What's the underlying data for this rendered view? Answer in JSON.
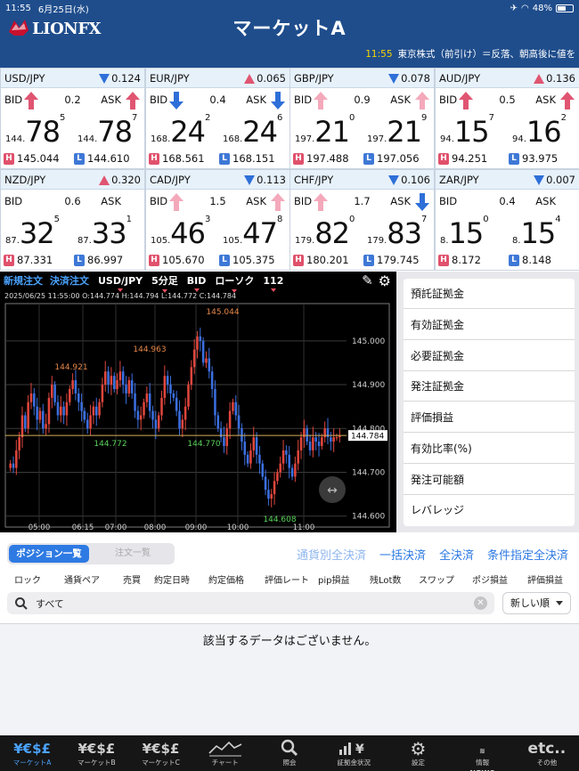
{
  "status_bar": {
    "time": "11:55",
    "date": "6月25日(水)",
    "battery": "48%"
  },
  "header": {
    "logo": "LIONFX",
    "title": "マーケットA",
    "ticker_time": "11:55",
    "ticker_text": "東京株式（前引け）＝反落、朝高後に値を"
  },
  "quotes": [
    {
      "pair": "USD/JPY",
      "change": "0.124",
      "change_dir": "down",
      "spread": "0.2",
      "bid_label": "BID",
      "ask_label": "ASK",
      "bid_dir": "up",
      "ask_dir": "up",
      "bid_pre": "144.",
      "bid_big": "78",
      "bid_frac": "5",
      "ask_pre": "144.",
      "ask_big": "78",
      "ask_frac": "7",
      "high": "145.044",
      "low": "144.610"
    },
    {
      "pair": "EUR/JPY",
      "change": "0.065",
      "change_dir": "up",
      "spread": "0.4",
      "bid_label": "BID",
      "ask_label": "ASK",
      "bid_dir": "down",
      "ask_dir": "down",
      "bid_pre": "168.",
      "bid_big": "24",
      "bid_frac": "2",
      "ask_pre": "168.",
      "ask_big": "24",
      "ask_frac": "6",
      "high": "168.561",
      "low": "168.151"
    },
    {
      "pair": "GBP/JPY",
      "change": "0.078",
      "change_dir": "down",
      "spread": "0.9",
      "bid_label": "BID",
      "ask_label": "ASK",
      "bid_dir": "up-light",
      "ask_dir": "up-light",
      "bid_pre": "197.",
      "bid_big": "21",
      "bid_frac": "0",
      "ask_pre": "197.",
      "ask_big": "21",
      "ask_frac": "9",
      "high": "197.488",
      "low": "197.056"
    },
    {
      "pair": "AUD/JPY",
      "change": "0.136",
      "change_dir": "up",
      "spread": "0.5",
      "bid_label": "BID",
      "ask_label": "ASK",
      "bid_dir": "up",
      "ask_dir": "up",
      "bid_pre": "94.",
      "bid_big": "15",
      "bid_frac": "7",
      "ask_pre": "94.",
      "ask_big": "16",
      "ask_frac": "2",
      "high": "94.251",
      "low": "93.975"
    },
    {
      "pair": "NZD/JPY",
      "change": "0.320",
      "change_dir": "up",
      "spread": "0.6",
      "bid_label": "BID",
      "ask_label": "ASK",
      "bid_dir": "none",
      "ask_dir": "none",
      "bid_pre": "87.",
      "bid_big": "32",
      "bid_frac": "5",
      "ask_pre": "87.",
      "ask_big": "33",
      "ask_frac": "1",
      "high": "87.331",
      "low": "86.997"
    },
    {
      "pair": "CAD/JPY",
      "change": "0.113",
      "change_dir": "down",
      "spread": "1.5",
      "bid_label": "BID",
      "ask_label": "ASK",
      "bid_dir": "up-light",
      "ask_dir": "up-light",
      "bid_pre": "105.",
      "bid_big": "46",
      "bid_frac": "3",
      "ask_pre": "105.",
      "ask_big": "47",
      "ask_frac": "8",
      "high": "105.670",
      "low": "105.375"
    },
    {
      "pair": "CHF/JPY",
      "change": "0.106",
      "change_dir": "down",
      "spread": "1.7",
      "bid_label": "BID",
      "ask_label": "ASK",
      "bid_dir": "up-light",
      "ask_dir": "down",
      "bid_pre": "179.",
      "bid_big": "82",
      "bid_frac": "0",
      "ask_pre": "179.",
      "ask_big": "83",
      "ask_frac": "7",
      "high": "180.201",
      "low": "179.745"
    },
    {
      "pair": "ZAR/JPY",
      "change": "0.007",
      "change_dir": "down",
      "spread": "0.4",
      "bid_label": "BID",
      "ask_label": "ASK",
      "bid_dir": "none",
      "ask_dir": "none",
      "bid_pre": "8.",
      "bid_big": "15",
      "bid_frac": "0",
      "ask_pre": "8.",
      "ask_big": "15",
      "ask_frac": "4",
      "high": "8.172",
      "low": "8.148"
    }
  ],
  "chart_toolbar": {
    "new_order": "新規注文",
    "settle_order": "決済注文",
    "pair": "USD/JPY",
    "period": "5分足",
    "side": "BID",
    "style": "ローソク",
    "count": "112"
  },
  "chart_info": "2025/06/25 11:55:00   O:144.774  H:144.794  L:144.772  C:144.784",
  "chart_data": {
    "type": "candlestick",
    "pair": "USD/JPY",
    "period": "5分足",
    "ylim": [
      144.575,
      145.085
    ],
    "y_ticks": [
      "145.000",
      "144.900",
      "144.800",
      "144.700",
      "144.600"
    ],
    "x_ticks": [
      "05:00",
      "06:15",
      "07:00",
      "08:00",
      "09:00",
      "10:00",
      "11:00"
    ],
    "current_price": "144.784",
    "annotations": [
      {
        "label": "145.044",
        "kind": "high"
      },
      {
        "label": "144.963",
        "kind": "high"
      },
      {
        "label": "144.921",
        "kind": "high"
      },
      {
        "label": "144.772",
        "kind": "low"
      },
      {
        "label": "144.770",
        "kind": "low"
      },
      {
        "label": "144.608",
        "kind": "low"
      }
    ],
    "close_path": [
      144.72,
      144.71,
      144.75,
      144.78,
      144.83,
      144.8,
      144.86,
      144.88,
      144.85,
      144.82,
      144.84,
      144.8,
      144.81,
      144.87,
      144.9,
      144.86,
      144.83,
      144.85,
      144.83,
      144.86,
      144.89,
      144.91,
      144.88,
      144.86,
      144.84,
      144.82,
      144.8,
      144.83,
      144.85,
      144.83,
      144.86,
      144.9,
      144.93,
      144.9,
      144.92,
      144.89,
      144.91,
      144.93,
      144.9,
      144.88,
      144.91,
      144.88,
      144.84,
      144.82,
      144.83,
      144.86,
      144.88,
      144.84,
      144.82,
      144.8,
      144.83,
      144.87,
      144.92,
      144.9,
      144.88,
      144.87,
      144.84,
      144.8,
      144.82,
      144.85,
      144.9,
      144.94,
      144.98,
      145.01,
      145.0,
      144.95,
      144.96,
      144.93,
      144.89,
      144.83,
      144.8,
      144.78,
      144.76,
      144.8,
      144.84,
      144.86,
      144.83,
      144.8,
      144.77,
      144.74,
      144.72,
      144.75,
      144.78,
      144.74,
      144.72,
      144.69,
      144.66,
      144.64,
      144.65,
      144.68,
      144.7,
      144.72,
      144.75,
      144.74,
      144.71,
      144.69,
      144.72,
      144.75,
      144.78,
      144.8,
      144.77,
      144.75,
      144.78,
      144.77,
      144.76,
      144.78,
      144.8,
      144.78,
      144.77,
      144.78,
      144.78,
      144.784
    ]
  },
  "account": {
    "items": [
      "預託証拠金",
      "有効証拠金",
      "必要証拠金",
      "発注証拠金",
      "評価損益",
      "有効比率(%)",
      "発注可能額",
      "レバレッジ"
    ]
  },
  "positions": {
    "tab_positions": "ポジション一覧",
    "tab_orders": "注文一覧",
    "btn_currency_settle": "通貨別全決済",
    "btn_bulk_settle": "一括決済",
    "btn_all_settle": "全決済",
    "btn_cond_settle": "条件指定全決済",
    "columns": [
      "ロック",
      "通貨ペア",
      "売買",
      "約定日時",
      "約定価格",
      "評価レート",
      "pip損益",
      "残Lot数",
      "スワップ",
      "ポジ損益",
      "評価損益"
    ],
    "search_value": "すべて",
    "sort_value": "新しい順",
    "empty_message": "該当するデータはございません。"
  },
  "tabbar": [
    {
      "label": "マーケットA",
      "icon": "¥€$£",
      "active": true
    },
    {
      "label": "マーケットB",
      "icon": "¥€$£",
      "active": false
    },
    {
      "label": "マーケットC",
      "icon": "¥€$£",
      "active": false
    },
    {
      "label": "チャート",
      "icon": "chart-icon",
      "active": false
    },
    {
      "label": "照会",
      "icon": "search-icon",
      "active": false
    },
    {
      "label": "証拠金状況",
      "icon": "margin-icon",
      "active": false
    },
    {
      "label": "設定",
      "icon": "settings-icon",
      "active": false
    },
    {
      "label": "情報",
      "icon": "NEWS",
      "active": false
    },
    {
      "label": "その他",
      "icon": "etc..",
      "active": false
    }
  ],
  "colors": {
    "header": "#1f4d8c",
    "up": "#e05571",
    "down": "#2e6fd8",
    "accent": "#2e7ae3",
    "tab_active": "#4aa3ff"
  }
}
